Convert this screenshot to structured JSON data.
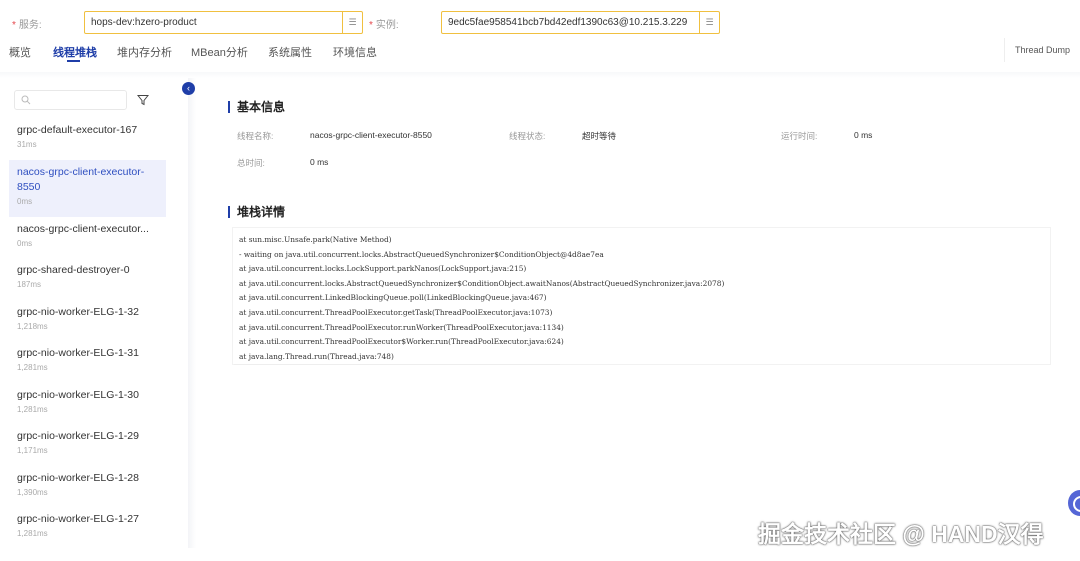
{
  "filters": {
    "service": {
      "label": "服务:",
      "value": "hops-dev:hzero-product"
    },
    "instance": {
      "label": "实例:",
      "value": "9edc5fae958541bcb7bd42edf1390c63@10.215.3.229"
    },
    "required_mark": "*",
    "picker_icon": "list-icon"
  },
  "tabs": [
    {
      "label": "概览"
    },
    {
      "label": "线程堆栈",
      "active": true
    },
    {
      "label": "堆内存分析"
    },
    {
      "label": "MBean分析"
    },
    {
      "label": "系统属性"
    },
    {
      "label": "环境信息"
    }
  ],
  "thread_dump_label": "Thread Dump",
  "sidebar": {
    "search_placeholder": "",
    "threads": [
      {
        "name": "grpc-default-executor-167",
        "duration": "31ms"
      },
      {
        "name": "nacos-grpc-client-executor-8550",
        "duration": "0ms",
        "selected": true
      },
      {
        "name": "nacos-grpc-client-executor...",
        "duration": "0ms"
      },
      {
        "name": "grpc-shared-destroyer-0",
        "duration": "187ms"
      },
      {
        "name": "grpc-nio-worker-ELG-1-32",
        "duration": "1,218ms"
      },
      {
        "name": "grpc-nio-worker-ELG-1-31",
        "duration": "1,281ms"
      },
      {
        "name": "grpc-nio-worker-ELG-1-30",
        "duration": "1,281ms"
      },
      {
        "name": "grpc-nio-worker-ELG-1-29",
        "duration": "1,171ms"
      },
      {
        "name": "grpc-nio-worker-ELG-1-28",
        "duration": "1,390ms"
      },
      {
        "name": "grpc-nio-worker-ELG-1-27",
        "duration": "1,281ms"
      }
    ]
  },
  "basic_info": {
    "title": "基本信息",
    "thread_name_label": "线程名称:",
    "thread_name": "nacos-grpc-client-executor-8550",
    "thread_state_label": "线程状态:",
    "thread_state": "超时等待",
    "run_time_label": "运行时间:",
    "run_time": "0 ms",
    "total_time_label": "总时间:",
    "total_time": "0 ms"
  },
  "stack": {
    "title": "堆栈详情",
    "lines": [
      "at sun.misc.Unsafe.park(Native Method)",
      "- waiting on java.util.concurrent.locks.AbstractQueuedSynchronizer$ConditionObject@4d8ae7ea",
      "at java.util.concurrent.locks.LockSupport.parkNanos(LockSupport.java:215)",
      "at java.util.concurrent.locks.AbstractQueuedSynchronizer$ConditionObject.awaitNanos(AbstractQueuedSynchronizer.java:2078)",
      "at java.util.concurrent.LinkedBlockingQueue.poll(LinkedBlockingQueue.java:467)",
      "at java.util.concurrent.ThreadPoolExecutor.getTask(ThreadPoolExecutor.java:1073)",
      "at java.util.concurrent.ThreadPoolExecutor.runWorker(ThreadPoolExecutor.java:1134)",
      "at java.util.concurrent.ThreadPoolExecutor$Worker.run(ThreadPoolExecutor.java:624)",
      "at java.lang.Thread.run(Thread.java:748)"
    ]
  },
  "watermark": "掘金技术社区 @ HAND汉得",
  "colors": {
    "accent": "#1f3ea8",
    "input_border": "#f0c040",
    "selected_bg": "#eef0fc"
  }
}
